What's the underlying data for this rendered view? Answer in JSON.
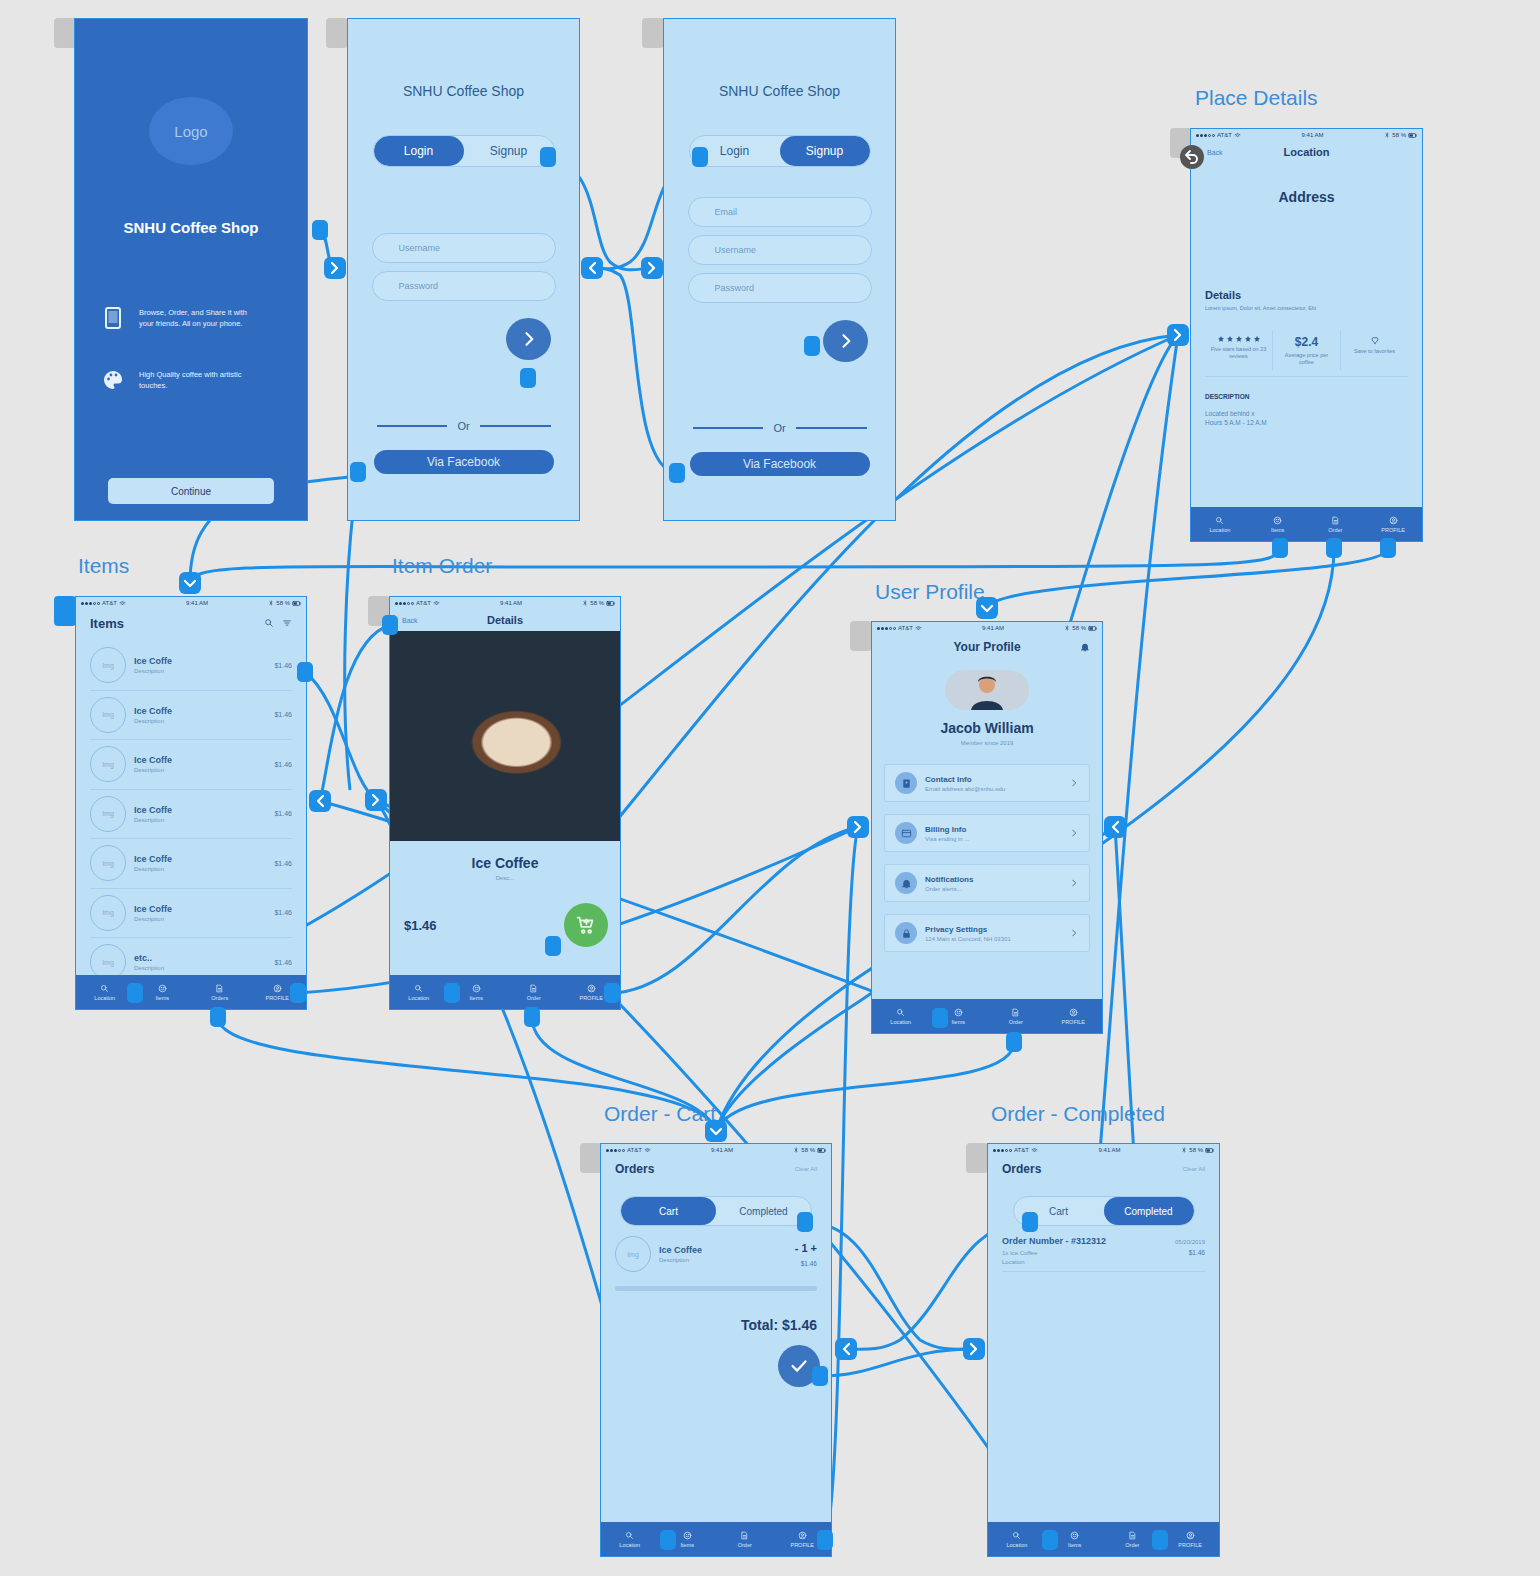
{
  "status_bar": {
    "carrier": "AT&T",
    "time": "9:41 AM",
    "battery": "58 %"
  },
  "splash": {
    "logo": "Logo",
    "title": "SNHU Coffee Shop",
    "features": [
      "Browse, Order, and Share it with your friends. All on your phone.",
      "High Quality coffee with artistic touches."
    ],
    "button": "Continue"
  },
  "login": {
    "title": "SNHU Coffee Shop",
    "tabs": [
      {
        "label": "Login",
        "selected": true
      },
      {
        "label": "Signup",
        "selected": false
      }
    ],
    "fields": [
      {
        "placeholder": "Username"
      },
      {
        "placeholder": "Password"
      }
    ],
    "divider": "Or",
    "facebook": "Via Facebook"
  },
  "signup": {
    "title": "SNHU Coffee Shop",
    "tabs": [
      {
        "label": "Login",
        "selected": false
      },
      {
        "label": "Signup",
        "selected": true
      }
    ],
    "fields": [
      {
        "placeholder": "Email"
      },
      {
        "placeholder": "Username"
      },
      {
        "placeholder": "Password"
      }
    ],
    "divider": "Or",
    "facebook": "Via Facebook"
  },
  "place_details": {
    "label": "Place Details",
    "back": "Back",
    "title": "Location",
    "address": "Address",
    "details_heading": "Details",
    "details_text": "Lorem ipsum, Dolor sit, Amet consectetur, Elit",
    "rating": {
      "stars": 5,
      "caption": "Five stars based on 23 reviews"
    },
    "price": {
      "value": "$2.4",
      "caption": "Average price per coffee"
    },
    "favorite": {
      "caption": "Save to favorites"
    },
    "description_heading": "DESCRIPTION",
    "description": [
      "Located behind x",
      "Hours 5 A.M - 12 A.M"
    ],
    "tabbar": [
      "Location",
      "Items",
      "Order",
      "PROFILE"
    ]
  },
  "items": {
    "label": "Items",
    "title": "Items",
    "rows": [
      {
        "image": "Img",
        "name": "Ice Coffe",
        "description": "Description",
        "price": "$1.46"
      },
      {
        "image": "Img",
        "name": "Ice Coffe",
        "description": "Description",
        "price": "$1.46"
      },
      {
        "image": "Img",
        "name": "Ice Coffe",
        "description": "Description",
        "price": "$1.46"
      },
      {
        "image": "Img",
        "name": "Ice Coffe",
        "description": "Description",
        "price": "$1.46"
      },
      {
        "image": "Img",
        "name": "Ice Coffe",
        "description": "Description",
        "price": "$1.46"
      },
      {
        "image": "Img",
        "name": "Ice Coffe",
        "description": "Description",
        "price": "$1.46"
      },
      {
        "image": "Img",
        "name": "etc..",
        "description": "Description",
        "price": "$1.46"
      }
    ],
    "tabbar": [
      "Location",
      "Items",
      "Orders",
      "PROFILE"
    ]
  },
  "item_order": {
    "label": "Item Order",
    "back": "Back",
    "title": "Details",
    "name": "Ice Coffee",
    "description": "Desc...",
    "price": "$1.46",
    "tabbar": [
      "Location",
      "Items",
      "Order",
      "PROFILE"
    ]
  },
  "user_profile": {
    "label": "User Profile",
    "title": "Your Profile",
    "name": "Jacob William",
    "member": "Member since 2019",
    "rows": [
      {
        "title": "Contact Info",
        "subtitle": "Email address abc@snhu.edu"
      },
      {
        "title": "Billing Info",
        "subtitle": "Visa ending in ..."
      },
      {
        "title": "Notifications",
        "subtitle": "Order alerts..."
      },
      {
        "title": "Privacy Settings",
        "subtitle": "124 Main st Concord, NH 03301"
      }
    ],
    "tabbar": [
      "Location",
      "Items",
      "Order",
      "PROFILE"
    ]
  },
  "order_cart": {
    "label": "Order - Cart",
    "title": "Orders",
    "clear": "Clear All",
    "tabs": [
      {
        "label": "Cart",
        "selected": true
      },
      {
        "label": "Completed",
        "selected": false
      }
    ],
    "item": {
      "image": "Img",
      "name": "Ice Coffee",
      "description": "Description",
      "quantity": "- 1 +",
      "price": "$1.46"
    },
    "total": "Total: $1.46",
    "tabbar": [
      "Location",
      "Items",
      "Order",
      "PROFILE"
    ]
  },
  "order_completed": {
    "label": "Order - Completed",
    "title": "Orders",
    "clear": "Clear All",
    "tabs": [
      {
        "label": "Cart",
        "selected": false
      },
      {
        "label": "Completed",
        "selected": true
      }
    ],
    "order": {
      "number": "Order Number - #312312",
      "date": "05/20/2019",
      "summary": "1x Ice Coffee",
      "price": "$1.46",
      "location": "Location"
    },
    "tabbar": [
      "Location",
      "Items",
      "Order",
      "PROFILE"
    ]
  }
}
